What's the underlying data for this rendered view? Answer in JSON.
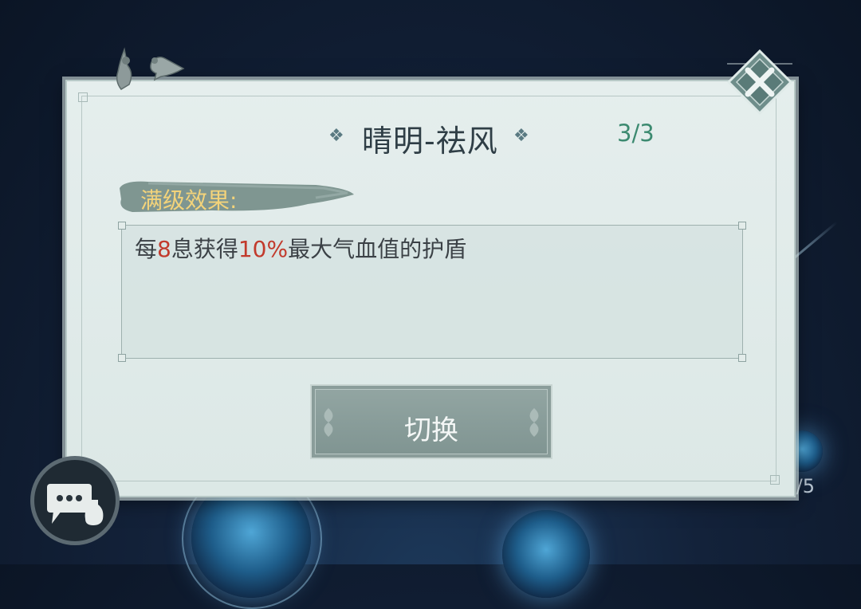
{
  "dialog": {
    "title": "晴明-祛风",
    "level": "3/3",
    "effect_label": "满级效果:",
    "description": {
      "prefix": "每",
      "interval": "8",
      "middle": "息获得",
      "percent": "10%",
      "suffix": "最大气血值的护盾"
    },
    "switch_label": "切换"
  },
  "background": {
    "page_count": "/5"
  },
  "icons": {
    "close": "close-icon",
    "chat": "chat-icon",
    "title_ornament": "diamond-ornament-icon",
    "birds": "bird-decoration-icon"
  },
  "colors": {
    "highlight": "#c23a2c",
    "level": "#3c8a70",
    "effect_label": "#f3d37a"
  }
}
